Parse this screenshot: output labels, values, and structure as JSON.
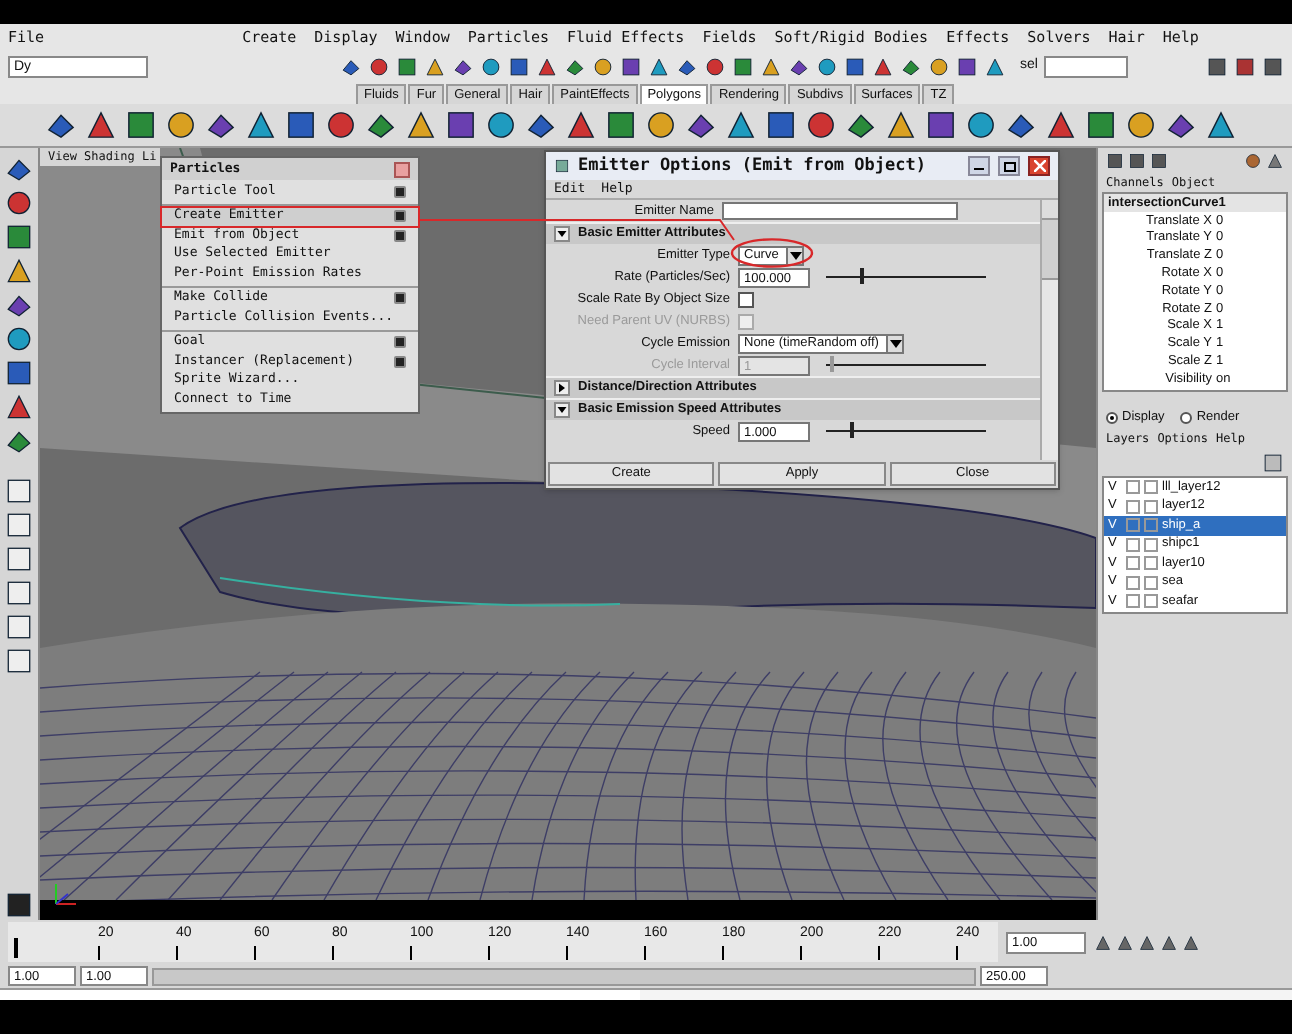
{
  "menu_bar": [
    "File",
    "Create",
    "Display",
    "Window",
    "Particles",
    "Fluid Effects",
    "Fields",
    "Soft/Rigid Bodies",
    "Effects",
    "Solvers",
    "Hair",
    "Help"
  ],
  "status_line": {
    "mode_menu": "Dy",
    "selection_label": "sel"
  },
  "shelf_tabs": [
    {
      "label": "Fluids",
      "selected": false
    },
    {
      "label": "Fur",
      "selected": false
    },
    {
      "label": "General",
      "selected": false
    },
    {
      "label": "Hair",
      "selected": false
    },
    {
      "label": "PaintEffects",
      "selected": false
    },
    {
      "label": "Polygons",
      "selected": true
    },
    {
      "label": "Rendering",
      "selected": false
    },
    {
      "label": "Subdivs",
      "selected": false
    },
    {
      "label": "Surfaces",
      "selected": false
    },
    {
      "label": "TZ",
      "selected": false
    }
  ],
  "viewport": {
    "menu": "View Shading Li"
  },
  "particles_menu": {
    "title": "Particles",
    "groups": [
      [
        {
          "label": "Particle Tool",
          "option_box": true,
          "annotated": false
        }
      ],
      [
        {
          "label": "Create Emitter",
          "option_box": true,
          "annotated": true
        },
        {
          "label": "Emit from Object",
          "option_box": true,
          "annotated": false
        },
        {
          "label": "Use Selected Emitter",
          "option_box": false,
          "annotated": false
        },
        {
          "label": "Per-Point Emission Rates",
          "option_box": false,
          "annotated": false
        }
      ],
      [
        {
          "label": "Make Collide",
          "option_box": true,
          "annotated": false
        },
        {
          "label": "Particle Collision Events...",
          "option_box": false,
          "annotated": false
        }
      ],
      [
        {
          "label": "Goal",
          "option_box": true,
          "annotated": false
        },
        {
          "label": "Instancer (Replacement)",
          "option_box": true,
          "annotated": false
        },
        {
          "label": "Sprite Wizard...",
          "option_box": false,
          "annotated": false
        },
        {
          "label": "Connect to Time",
          "option_box": false,
          "annotated": false
        }
      ]
    ]
  },
  "emitter_options": {
    "title": "Emitter Options (Emit from Object)",
    "menus": [
      "Edit",
      "Help"
    ],
    "emitter_name": {
      "label": "Emitter Name"
    },
    "sections": [
      {
        "title": "Basic Emitter Attributes",
        "expanded": true,
        "rows": [
          {
            "kind": "dropdown",
            "label": "Emitter Type",
            "value": "Curve"
          },
          {
            "kind": "slider",
            "label": "Rate (Particles/Sec)",
            "value": "100.000",
            "level": 0.22,
            "disabled": false
          },
          {
            "kind": "checkbox",
            "label": "Scale Rate By Object Size",
            "checked": false,
            "disabled": false
          },
          {
            "kind": "checkbox",
            "label": "Need Parent UV (NURBS)",
            "checked": false,
            "disabled": true
          },
          {
            "kind": "dropdown",
            "label": "Cycle Emission",
            "value": "None (timeRandom off)"
          },
          {
            "kind": "slider",
            "label": "Cycle Interval",
            "value": "1",
            "level": 0.03,
            "disabled": true
          }
        ]
      },
      {
        "title": "Distance/Direction Attributes",
        "expanded": false
      },
      {
        "title": "Basic Emission Speed Attributes",
        "expanded": true,
        "rows": [
          {
            "kind": "slider",
            "label": "Speed",
            "value": "1.000",
            "level": 0.15,
            "disabled": false
          }
        ]
      }
    ],
    "buttons": [
      "Create",
      "Apply",
      "Close"
    ]
  },
  "channel_box": {
    "menus": [
      "Channels",
      "Object"
    ],
    "object": "intersectionCurve1",
    "channels": [
      {
        "name": "Translate X",
        "value": "0"
      },
      {
        "name": "Translate Y",
        "value": "0"
      },
      {
        "name": "Translate Z",
        "value": "0"
      },
      {
        "name": "Rotate X",
        "value": "0"
      },
      {
        "name": "Rotate Y",
        "value": "0"
      },
      {
        "name": "Rotate Z",
        "value": "0"
      },
      {
        "name": "Scale X",
        "value": "1"
      },
      {
        "name": "Scale Y",
        "value": "1"
      },
      {
        "name": "Scale Z",
        "value": "1"
      },
      {
        "name": "Visibility",
        "value": "on"
      }
    ]
  },
  "layer_editor": {
    "modes": [
      {
        "label": "Display",
        "selected": true
      },
      {
        "label": "Render",
        "selected": false
      }
    ],
    "menus": [
      "Layers",
      "Options",
      "Help"
    ],
    "layers": [
      {
        "visibility": "V",
        "name": "lll_layer12",
        "selected": false
      },
      {
        "visibility": "V",
        "name": "layer12",
        "selected": false
      },
      {
        "visibility": "V",
        "name": "ship_a",
        "selected": true
      },
      {
        "visibility": "V",
        "name": "shipc1",
        "selected": false
      },
      {
        "visibility": "V",
        "name": "layer10",
        "selected": false
      },
      {
        "visibility": "V",
        "name": "sea",
        "selected": false
      },
      {
        "visibility": "V",
        "name": "seafar",
        "selected": false
      }
    ]
  },
  "time_slider": {
    "ticks": [
      "20",
      "40",
      "60",
      "80",
      "100",
      "120",
      "140",
      "160",
      "180",
      "200",
      "220",
      "240"
    ],
    "current_time": "1.00",
    "level": 0
  },
  "range_slider": {
    "start_time": "1.00",
    "playback_start": "1.00",
    "playback_end": "250.00",
    "level": 1
  }
}
